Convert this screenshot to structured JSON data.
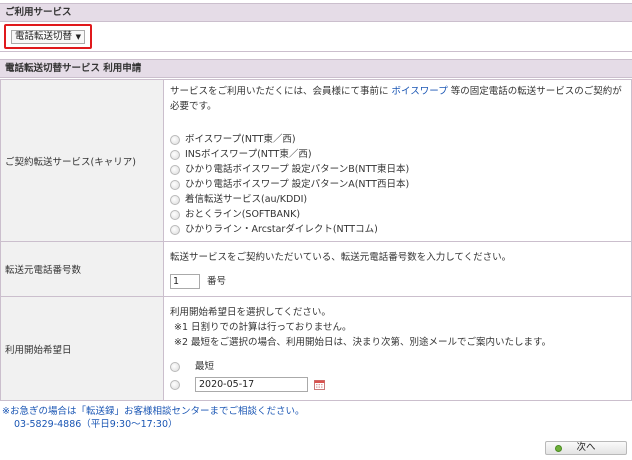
{
  "header1": {
    "title": "ご利用サービス"
  },
  "service_select": {
    "value": "電話転送切替"
  },
  "header2": {
    "title": "電話転送切替サービス 利用申請"
  },
  "carrier": {
    "label": "ご契約転送サービス(キャリア)",
    "intro_pre": "サービスをご利用いただくには、会員様にて事前に",
    "intro_link": "ボイスワープ",
    "intro_post": "等の固定電話の転送サービスのご契約が必要です。",
    "options": [
      "ボイスワープ(NTT東／西)",
      "INSボイスワープ(NTT東／西)",
      "ひかり電話ボイスワープ 設定パターンB(NTT東日本)",
      "ひかり電話ボイスワープ 設定パターンA(NTT西日本)",
      "着信転送サービス(au/KDDI)",
      "おとくライン(SOFTBANK)",
      "ひかりライン・Arcstarダイレクト(NTTコム)"
    ]
  },
  "count": {
    "label": "転送元電話番号数",
    "description": "転送サービスをご契約いただいている、転送元電話番号数を入力してください。",
    "value": "1",
    "unit": "番号"
  },
  "date": {
    "label": "利用開始希望日",
    "line1": "利用開始希望日を選択してください。",
    "line2": "※1 日割りでの計算は行っておりません。",
    "line3": "※2 最短をご選択の場合、利用開始日は、決まり次第、別途メールでご案内いたします。",
    "option_earliest": "最短",
    "date_value": "2020-05-17"
  },
  "footer": {
    "note_line1": "※お急ぎの場合は「転送録」お客様相談センターまでご相談ください。",
    "note_line2": "03-5829-4886（平日9:30～17:30）",
    "next_label": "次へ"
  }
}
